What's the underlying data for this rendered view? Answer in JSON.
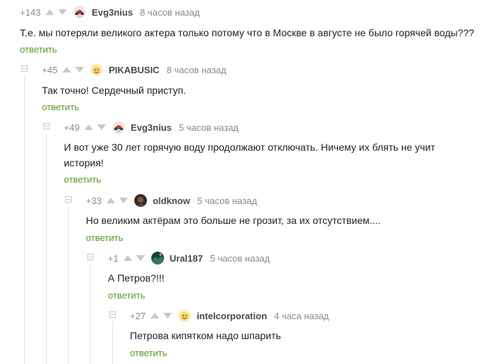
{
  "colors": {
    "accent": "#5a9a2c",
    "muted": "#8a8a8a",
    "line": "#e6e6e6"
  },
  "comments": [
    {
      "rating": "+143",
      "user": "Evg3nius",
      "avatar": "helmet-avatar",
      "time": "8 часов назад",
      "text": "Т.е. мы потеряли великого актера только потому что в Москве в августе не было горячей воды???",
      "reply": "ответить"
    },
    {
      "rating": "+45",
      "user": "PIKABUSIC",
      "avatar": "yellow-face-avatar",
      "time": "8 часов назад",
      "text": "Так точно! Сердечный приступ.",
      "reply": "ответить"
    },
    {
      "rating": "+49",
      "user": "Evg3nius",
      "avatar": "helmet-avatar",
      "time": "5 часов назад",
      "text": "И вот уже 30 лет горячую воду продолжают отключать. Ничему их блять не учит история!",
      "reply": "ответить"
    },
    {
      "rating": "+33",
      "user": "oldknow",
      "avatar": "dark-avatar",
      "time": "5 часов назад",
      "text": "Но великим актёрам это больше не грозит, за их отсутствием....",
      "reply": "ответить"
    },
    {
      "rating": "+1",
      "user": "Ural187",
      "avatar": "landscape-avatar",
      "time": "5 часов назад",
      "text": "А Петров?!!!",
      "reply": "ответить"
    },
    {
      "rating": "+27",
      "user": "intelcorporation",
      "avatar": "yellow-face-avatar",
      "time": "4 часа назад",
      "text": "Петрова кипятком надо шпарить",
      "reply": "ответить"
    }
  ]
}
